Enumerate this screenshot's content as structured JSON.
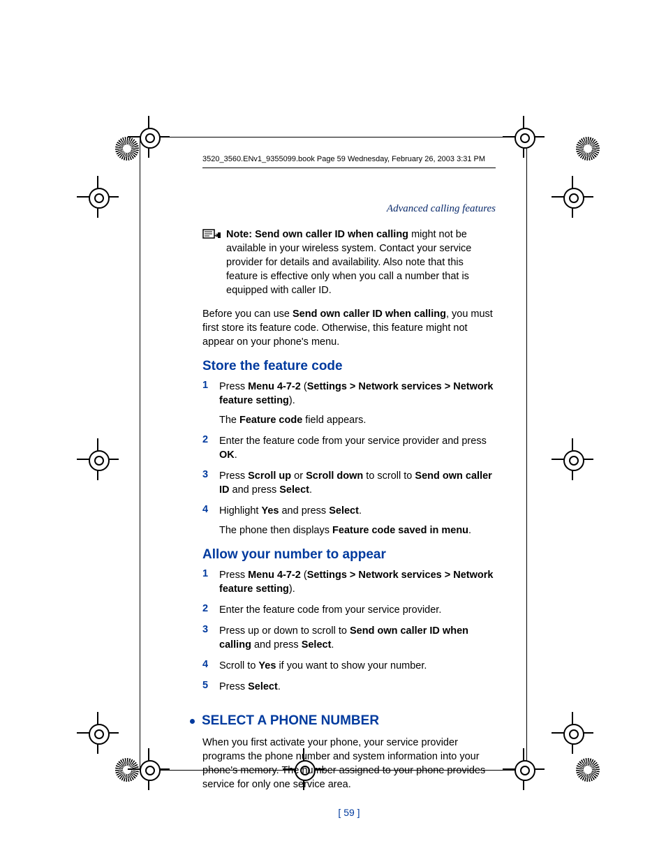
{
  "print_header": "3520_3560.ENv1_9355099.book  Page 59  Wednesday, February 26, 2003  3:31 PM",
  "section_header": "Advanced calling features",
  "note": {
    "prefix": "Note: Send own caller ID when calling",
    "rest": " might not be available in your wireless system. Contact your service provider for details and availability. Also note that this feature is effective only when you call a number that is equipped with caller ID."
  },
  "intro": {
    "pre": "Before you can use ",
    "bold": "Send own caller ID when calling",
    "post": ", you must first store its feature code. Otherwise, this feature might not appear on your phone's menu."
  },
  "store": {
    "heading": "Store the feature code",
    "items": [
      {
        "num": "1",
        "runs": [
          {
            "t": "Press "
          },
          {
            "t": "Menu 4-7-2",
            "b": true
          },
          {
            "t": " ("
          },
          {
            "t": "Settings > Network services > Network feature setting",
            "b": true
          },
          {
            "t": ")."
          }
        ],
        "sub_runs": [
          {
            "t": "The "
          },
          {
            "t": "Feature code",
            "b": true
          },
          {
            "t": " field appears."
          }
        ]
      },
      {
        "num": "2",
        "runs": [
          {
            "t": "Enter the feature code from your service provider and press "
          },
          {
            "t": "OK",
            "b": true
          },
          {
            "t": "."
          }
        ]
      },
      {
        "num": "3",
        "runs": [
          {
            "t": "Press "
          },
          {
            "t": "Scroll up",
            "b": true
          },
          {
            "t": " or "
          },
          {
            "t": "Scroll down",
            "b": true
          },
          {
            "t": " to scroll to "
          },
          {
            "t": "Send own caller ID",
            "b": true
          },
          {
            "t": " and press "
          },
          {
            "t": "Select",
            "b": true
          },
          {
            "t": "."
          }
        ]
      },
      {
        "num": "4",
        "runs": [
          {
            "t": "Highlight "
          },
          {
            "t": "Yes",
            "b": true
          },
          {
            "t": " and press "
          },
          {
            "t": "Select",
            "b": true
          },
          {
            "t": "."
          }
        ],
        "sub_runs": [
          {
            "t": "The phone then displays "
          },
          {
            "t": "Feature code saved in menu",
            "b": true
          },
          {
            "t": "."
          }
        ]
      }
    ]
  },
  "allow": {
    "heading": "Allow your number to appear",
    "items": [
      {
        "num": "1",
        "runs": [
          {
            "t": "Press "
          },
          {
            "t": "Menu 4-7-2",
            "b": true
          },
          {
            "t": " ("
          },
          {
            "t": "Settings > Network services > Network feature setting",
            "b": true
          },
          {
            "t": ")."
          }
        ]
      },
      {
        "num": "2",
        "runs": [
          {
            "t": "Enter the feature code from your service provider."
          }
        ]
      },
      {
        "num": "3",
        "runs": [
          {
            "t": "Press up or down to scroll to "
          },
          {
            "t": "Send own caller ID when calling",
            "b": true
          },
          {
            "t": " and press "
          },
          {
            "t": "Select",
            "b": true
          },
          {
            "t": "."
          }
        ]
      },
      {
        "num": "4",
        "runs": [
          {
            "t": "Scroll to "
          },
          {
            "t": "Yes",
            "b": true
          },
          {
            "t": " if you want to show your number."
          }
        ]
      },
      {
        "num": "5",
        "runs": [
          {
            "t": "Press "
          },
          {
            "t": "Select",
            "b": true
          },
          {
            "t": "."
          }
        ]
      }
    ]
  },
  "select_phone": {
    "heading": "SELECT A PHONE NUMBER",
    "paragraph": "When you first activate your phone, your service provider programs the phone number and system information into your phone's memory. The number assigned to your phone provides service for only one service area."
  },
  "page_number": "[ 59 ]"
}
